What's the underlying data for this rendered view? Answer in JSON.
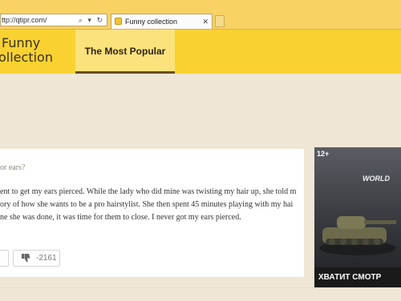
{
  "browser": {
    "address": "ttp://qtipr.com/",
    "address_controls": "⌕ ▾ ↻",
    "tab_title": "Funny collection",
    "tab_close": "✕"
  },
  "site": {
    "logo_line1": "Funny",
    "logo_line2": "ollection",
    "nav_active": "The Most Popular"
  },
  "post": {
    "question": "or ears?",
    "lines": [
      "ent to get my ears pierced. While the lady who did mine was twisting my hair up, she told m",
      "ory of how she wants to be a pro hairstylist. She then spent 45 minutes playing with my hai",
      "ne she was done, it was time for them to close. I never got my ears pierced."
    ],
    "dislike_count": "-2161"
  },
  "ad": {
    "age_label": "12+",
    "brand": "WORLD",
    "banner_text": "ХВАТИТ СМОТР"
  },
  "colors": {
    "header": "#f9d232",
    "nav_active": "#fce27c",
    "page_bg": "#f0e6d6"
  }
}
